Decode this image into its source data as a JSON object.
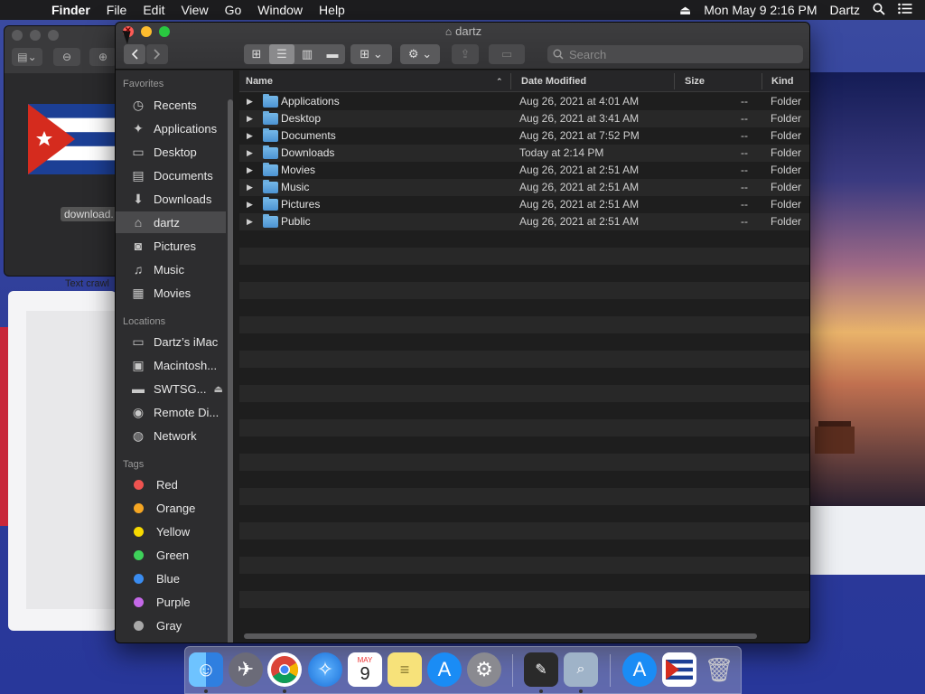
{
  "menubar": {
    "app": "Finder",
    "items": [
      "File",
      "Edit",
      "View",
      "Go",
      "Window",
      "Help"
    ],
    "clock": "Mon May 9  2:16 PM",
    "user": "Dartz"
  },
  "preview_window": {
    "filename": "download."
  },
  "desktop": {
    "text_crawl": "Text crawl"
  },
  "finder": {
    "title": "dartz",
    "search_placeholder": "Search",
    "sidebar": {
      "favorites_header": "Favorites",
      "favorites": [
        {
          "label": "Recents",
          "icon": "clock-icon"
        },
        {
          "label": "Applications",
          "icon": "applications-icon"
        },
        {
          "label": "Desktop",
          "icon": "desktop-icon"
        },
        {
          "label": "Documents",
          "icon": "documents-icon"
        },
        {
          "label": "Downloads",
          "icon": "downloads-icon"
        },
        {
          "label": "dartz",
          "icon": "home-icon",
          "selected": true
        },
        {
          "label": "Pictures",
          "icon": "camera-icon"
        },
        {
          "label": "Music",
          "icon": "music-icon"
        },
        {
          "label": "Movies",
          "icon": "film-icon"
        }
      ],
      "locations_header": "Locations",
      "locations": [
        {
          "label": "Dartz’s iMac",
          "icon": "imac-icon"
        },
        {
          "label": "Macintosh...",
          "icon": "hard-drive-icon"
        },
        {
          "label": "SWTSG...",
          "icon": "external-drive-icon",
          "eject": true
        },
        {
          "label": "Remote Di...",
          "icon": "disc-icon"
        },
        {
          "label": "Network",
          "icon": "globe-icon"
        }
      ],
      "tags_header": "Tags",
      "tags": [
        {
          "label": "Red",
          "color": "#ef5350"
        },
        {
          "label": "Orange",
          "color": "#f5a623"
        },
        {
          "label": "Yellow",
          "color": "#f7d900"
        },
        {
          "label": "Green",
          "color": "#3ed15a"
        },
        {
          "label": "Blue",
          "color": "#3a8cf0"
        },
        {
          "label": "Purple",
          "color": "#c468e8"
        },
        {
          "label": "Gray",
          "color": "#a8a8a8"
        }
      ]
    },
    "columns": {
      "name": "Name",
      "date": "Date Modified",
      "size": "Size",
      "kind": "Kind"
    },
    "files": [
      {
        "name": "Applications",
        "date": "Aug 26, 2021 at 4:01 AM",
        "size": "--",
        "kind": "Folder"
      },
      {
        "name": "Desktop",
        "date": "Aug 26, 2021 at 3:41 AM",
        "size": "--",
        "kind": "Folder"
      },
      {
        "name": "Documents",
        "date": "Aug 26, 2021 at 7:52 PM",
        "size": "--",
        "kind": "Folder"
      },
      {
        "name": "Downloads",
        "date": "Today at 2:14 PM",
        "size": "--",
        "kind": "Folder"
      },
      {
        "name": "Movies",
        "date": "Aug 26, 2021 at 2:51 AM",
        "size": "--",
        "kind": "Folder"
      },
      {
        "name": "Music",
        "date": "Aug 26, 2021 at 2:51 AM",
        "size": "--",
        "kind": "Folder"
      },
      {
        "name": "Pictures",
        "date": "Aug 26, 2021 at 2:51 AM",
        "size": "--",
        "kind": "Folder"
      },
      {
        "name": "Public",
        "date": "Aug 26, 2021 at 2:51 AM",
        "size": "--",
        "kind": "Folder"
      }
    ]
  },
  "dock": {
    "calendar_month": "MAY",
    "calendar_day": "9",
    "apps": [
      {
        "name": "finder-icon",
        "color": "#3aa0f0"
      },
      {
        "name": "launchpad-icon",
        "color": "#6b6b78"
      },
      {
        "name": "chrome-icon",
        "color": "#ffffff"
      },
      {
        "name": "safari-icon",
        "color": "#2f8ef0"
      },
      {
        "name": "calendar-icon",
        "color": "#ffffff"
      },
      {
        "name": "notes-icon",
        "color": "#f7e27a"
      },
      {
        "name": "app-store-icon",
        "color": "#1a8cf5"
      },
      {
        "name": "system-preferences-icon",
        "color": "#8a8a90"
      },
      {
        "name": "screenshot-app-icon",
        "color": "#2a2a2a"
      },
      {
        "name": "preview-icon",
        "color": "#9fb3c8"
      },
      {
        "name": "app-store-download-icon",
        "color": "#1a8cf5"
      },
      {
        "name": "flag-document-icon",
        "color": "#ffffff"
      },
      {
        "name": "trash-icon",
        "color": "#9a9aa0"
      }
    ]
  }
}
